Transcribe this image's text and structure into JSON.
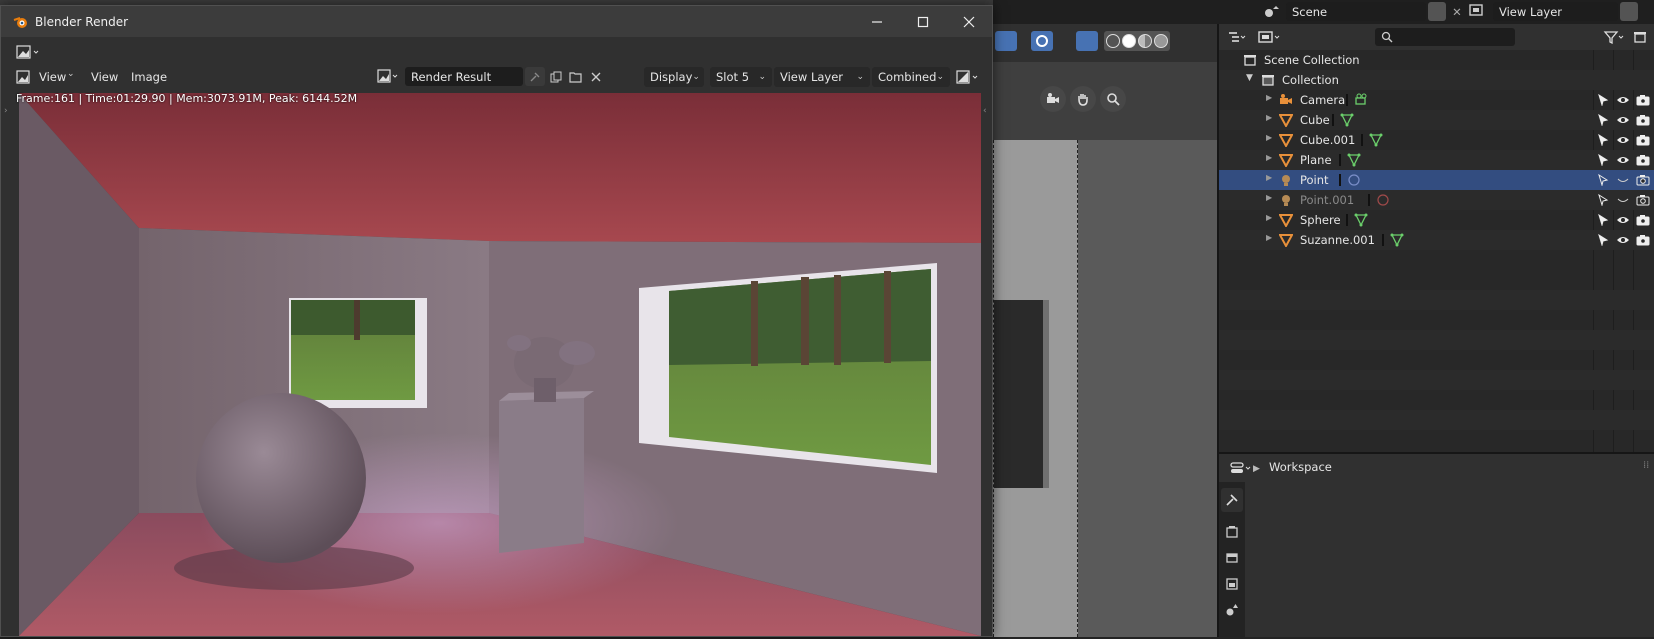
{
  "render_window": {
    "title": "Blender Render",
    "menus": {
      "view_dropdown": "View",
      "view": "View",
      "image": "Image"
    },
    "image_name": "Render Result",
    "display": "Display",
    "slot": "Slot 5",
    "view_layer": "View Layer",
    "pass": "Combined",
    "stats": "Frame:161 | Time:01:29.90 | Mem:3073.91M, Peak: 6144.52M"
  },
  "topbar": {
    "scene": "Scene",
    "view_layer": "View Layer"
  },
  "outliner": {
    "scene_collection": "Scene Collection",
    "collection": "Collection",
    "items": [
      {
        "label": "Camera",
        "type": "camera",
        "selected": false,
        "disabled": false
      },
      {
        "label": "Cube",
        "type": "mesh",
        "selected": false,
        "disabled": false
      },
      {
        "label": "Cube.001",
        "type": "mesh",
        "selected": false,
        "disabled": false
      },
      {
        "label": "Plane",
        "type": "mesh",
        "selected": false,
        "disabled": false
      },
      {
        "label": "Point",
        "type": "light",
        "selected": true,
        "disabled": true
      },
      {
        "label": "Point.001",
        "type": "light",
        "selected": false,
        "disabled": true
      },
      {
        "label": "Sphere",
        "type": "mesh",
        "selected": false,
        "disabled": false
      },
      {
        "label": "Suzanne.001",
        "type": "mesh",
        "selected": false,
        "disabled": false
      }
    ]
  },
  "properties": {
    "panel": "Workspace"
  },
  "colors": {
    "accent": "#4772b3",
    "selection": "#334d80",
    "object_orange": "#e8903a",
    "mesh_green": "#6bcf6b"
  }
}
